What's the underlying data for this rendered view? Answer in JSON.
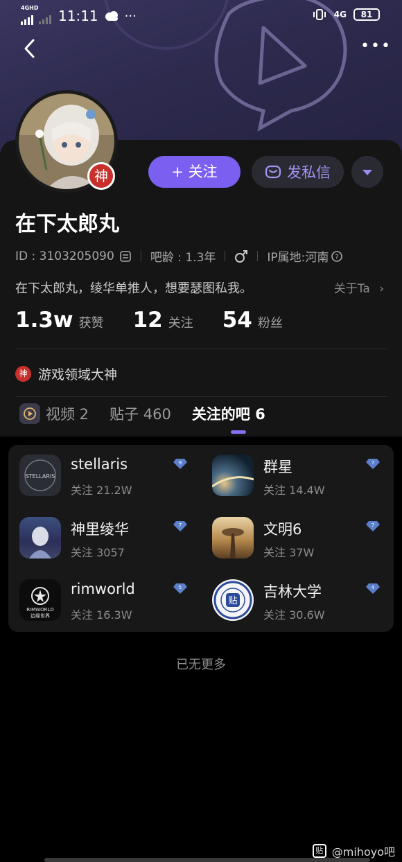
{
  "status": {
    "network_label": "4GHD",
    "time": "11:11",
    "mobile_label": "4G",
    "battery": "81"
  },
  "profile": {
    "name": "在下太郎丸",
    "god_badge": "神",
    "id_text": "ID : 3103205090",
    "bar_age": "吧龄 : 1.3年",
    "ip": "IP属地:河南",
    "bio": "在下太郎丸，绫华单推人，想要瑟图私我。",
    "about_label": "关于Ta"
  },
  "actions": {
    "follow_label": "+ 关注",
    "dm_label": "发私信"
  },
  "stats": [
    {
      "num": "1.3w",
      "label": "获赞"
    },
    {
      "num": "12",
      "label": "关注"
    },
    {
      "num": "54",
      "label": "粉丝"
    }
  ],
  "honor": {
    "badge": "神",
    "text": "游戏领域大神"
  },
  "tabs": [
    {
      "label": "视频 2"
    },
    {
      "label": "贴子 460"
    },
    {
      "label": "关注的吧 6"
    }
  ],
  "bars": [
    {
      "name": "stellaris",
      "follow": "关注 21.2W",
      "level": "9",
      "icon_text": "STELLARIS"
    },
    {
      "name": "群星",
      "follow": "关注 14.4W",
      "level": "7",
      "icon_text": ""
    },
    {
      "name": "神里绫华",
      "follow": "关注 3057",
      "level": "7",
      "icon_text": ""
    },
    {
      "name": "文明6",
      "follow": "关注 37W",
      "level": "7",
      "icon_text": ""
    },
    {
      "name": "rimworld",
      "follow": "关注 16.3W",
      "level": "5",
      "icon_text": "RIMWORLD",
      "icon_sub": "边缘世界"
    },
    {
      "name": "吉林大学",
      "follow": "关注 30.6W",
      "level": "4",
      "icon_text": "贴"
    }
  ],
  "footer": {
    "no_more": "已无更多",
    "watermark_icon": "贴",
    "watermark": "@mihoyo吧"
  },
  "colors": {
    "accent": "#7b5ff0",
    "god_red": "#c8302b",
    "level_gem": "#5b7fc9"
  }
}
